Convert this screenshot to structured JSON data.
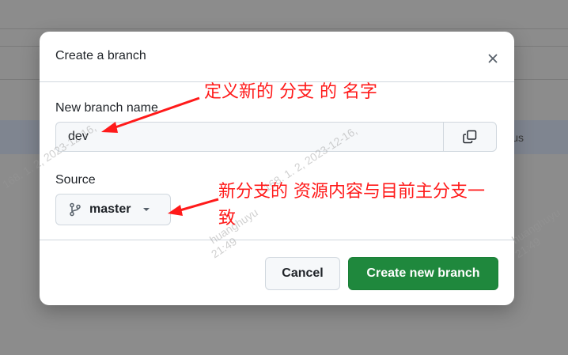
{
  "background": {
    "row_text": "us"
  },
  "modal": {
    "title": "Create a branch",
    "close_icon": "x-icon",
    "new_branch_label": "New branch name",
    "branch_value": "dev",
    "copy_icon": "copy-icon",
    "source_label": "Source",
    "source_branch": "master",
    "branch_icon": "git-branch-icon",
    "caret_icon": "triangle-down-icon",
    "cancel_label": "Cancel",
    "create_label": "Create new branch"
  },
  "annotations": {
    "name_note": "定义新的 分支 的 名字",
    "source_note_line1": "新分支的 资源内容与目前主分支一",
    "source_note_line2": "致"
  },
  "watermarks": {
    "w1": "168. 1. 2, 2023-12-16,",
    "w2": "168. 1. 2, 2023-12-16,",
    "w3": "huanghuyu",
    "w4": "21:49",
    "w5": "huanghuyu",
    "w6": "21:49"
  },
  "colors": {
    "primary_button": "#1f883d",
    "annotation": "#ff1a1a",
    "overlay": "#8c8c8c"
  }
}
